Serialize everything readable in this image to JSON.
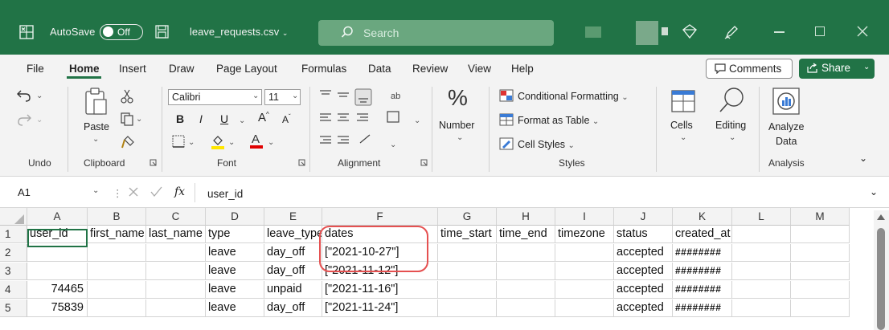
{
  "titlebar": {
    "autosave_label": "AutoSave",
    "autosave_state": "Off",
    "filename": "leave_requests.csv",
    "search_placeholder": "Search",
    "bg_color": "#217346"
  },
  "menu": {
    "items": [
      "File",
      "Home",
      "Insert",
      "Draw",
      "Page Layout",
      "Formulas",
      "Data",
      "Review",
      "View",
      "Help"
    ],
    "active": "Home",
    "comments_label": "Comments",
    "share_label": "Share"
  },
  "ribbon": {
    "undo": {
      "group": "Undo"
    },
    "clipboard": {
      "group": "Clipboard",
      "paste": "Paste"
    },
    "font": {
      "group": "Font",
      "name": "Calibri",
      "size": "11",
      "bold": "B",
      "italic": "I",
      "underline": "U"
    },
    "alignment": {
      "group": "Alignment"
    },
    "number": {
      "label": "Number"
    },
    "styles": {
      "group": "Styles",
      "conditional": "Conditional Formatting",
      "format_table": "Format as Table",
      "cell_styles": "Cell Styles"
    },
    "cells": {
      "label": "Cells"
    },
    "editing": {
      "label": "Editing"
    },
    "analysis": {
      "group": "Analysis",
      "analyze_line1": "Analyze",
      "analyze_line2": "Data"
    }
  },
  "formula_bar": {
    "name_box": "A1",
    "fx": "fx",
    "content": "user_id"
  },
  "sheet": {
    "columns": [
      "A",
      "B",
      "C",
      "D",
      "E",
      "F",
      "G",
      "H",
      "I",
      "J",
      "K",
      "L",
      "M"
    ],
    "rows": [
      [
        "user_id",
        "first_name",
        "last_name",
        "type",
        "leave_type",
        "dates",
        "time_start",
        "time_end",
        "timezone",
        "status",
        "created_at",
        "",
        ""
      ],
      [
        "",
        "",
        "",
        "leave",
        "day_off",
        "[\"2021-10-27\"]",
        "",
        "",
        "",
        "accepted",
        "########",
        "",
        ""
      ],
      [
        "",
        "",
        "",
        "leave",
        "day_off",
        "[\"2021-11-12\"]",
        "",
        "",
        "",
        "accepted",
        "########",
        "",
        ""
      ],
      [
        "74465",
        "",
        "",
        "leave",
        "unpaid",
        "[\"2021-11-16\"]",
        "",
        "",
        "",
        "accepted",
        "########",
        "",
        ""
      ],
      [
        "75839",
        "",
        "",
        "leave",
        "day_off",
        "[\"2021-11-24\"]",
        "",
        "",
        "",
        "accepted",
        "########",
        "",
        ""
      ]
    ],
    "row_numbers": [
      "1",
      "2",
      "3",
      "4",
      "5"
    ],
    "selected_cell": "A1",
    "highlight_color": "#e55050"
  }
}
